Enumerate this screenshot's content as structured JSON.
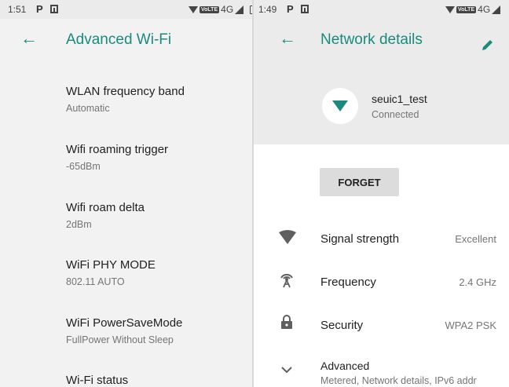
{
  "left": {
    "status": {
      "time": "1:51",
      "p_icon": "P",
      "volte": "VoLTE",
      "network": "4G"
    },
    "appbar": {
      "title": "Advanced Wi-Fi",
      "back_icon": "arrow-back-icon"
    },
    "prefs": [
      {
        "title": "WLAN frequency band",
        "summary": "Automatic"
      },
      {
        "title": "Wifi roaming trigger",
        "summary": "-65dBm"
      },
      {
        "title": "Wifi roam delta",
        "summary": "2dBm"
      },
      {
        "title": "WiFi PHY MODE",
        "summary": "802.11 AUTO"
      },
      {
        "title": "WiFi PowerSaveMode",
        "summary": "FullPower Without Sleep"
      },
      {
        "title": "Wi-Fi status",
        "summary": ""
      }
    ]
  },
  "right": {
    "status": {
      "time": "1:49",
      "p_icon": "P",
      "volte": "VoLTE",
      "network": "4G"
    },
    "appbar": {
      "title": "Network details",
      "back_icon": "arrow-back-icon",
      "edit_icon": "pencil-icon"
    },
    "network": {
      "ssid": "seuic1_test",
      "status": "Connected"
    },
    "forget_label": "FORGET",
    "details": [
      {
        "label": "Signal strength",
        "value": "Excellent",
        "icon": "wifi-signal-icon"
      },
      {
        "label": "Frequency",
        "value": "2.4 GHz",
        "icon": "antenna-icon"
      },
      {
        "label": "Security",
        "value": "WPA2 PSK",
        "icon": "lock-icon"
      }
    ],
    "advanced": {
      "label": "Advanced",
      "summary": "Metered, Network details, IPv6 addr",
      "icon": "chevron-down-icon"
    }
  },
  "colors": {
    "accent": "#1a8a7e",
    "header_bg": "#ebebeb",
    "list_bg": "#f2f2f2"
  }
}
